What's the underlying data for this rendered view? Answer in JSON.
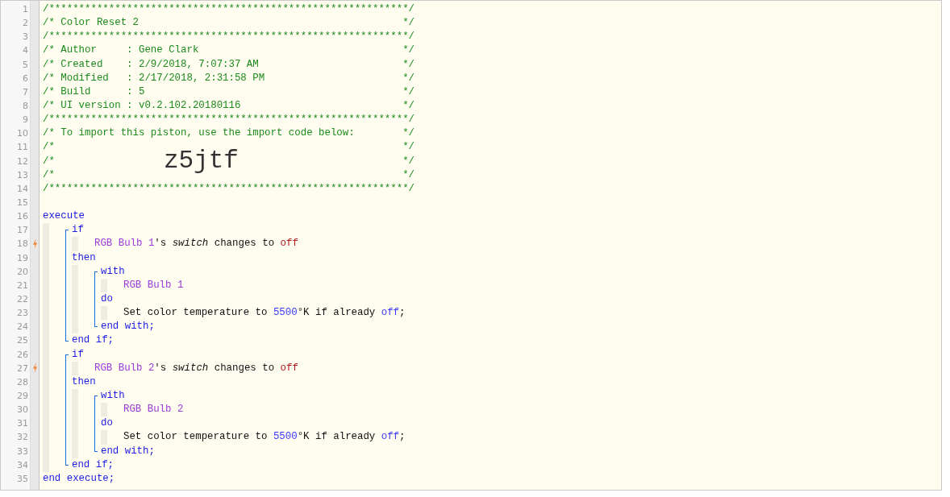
{
  "lines": [
    {
      "number": "1",
      "tokens": [
        {
          "kind": "comment",
          "text": "/************************************************************/"
        }
      ]
    },
    {
      "number": "2",
      "tokens": [
        {
          "kind": "comment",
          "text": "/* Color Reset 2"
        },
        {
          "kind": "comment-end",
          "text": "*/"
        }
      ]
    },
    {
      "number": "3",
      "tokens": [
        {
          "kind": "comment",
          "text": "/************************************************************/"
        }
      ]
    },
    {
      "number": "4",
      "tokens": [
        {
          "kind": "comment",
          "text": "/* Author     : Gene Clark"
        },
        {
          "kind": "comment-end",
          "text": "*/"
        }
      ]
    },
    {
      "number": "5",
      "tokens": [
        {
          "kind": "comment",
          "text": "/* Created    : 2/9/2018, 7:07:37 AM"
        },
        {
          "kind": "comment-end",
          "text": "*/"
        }
      ]
    },
    {
      "number": "6",
      "tokens": [
        {
          "kind": "comment",
          "text": "/* Modified   : 2/17/2018, 2:31:58 PM"
        },
        {
          "kind": "comment-end",
          "text": "*/"
        }
      ]
    },
    {
      "number": "7",
      "tokens": [
        {
          "kind": "comment",
          "text": "/* Build      : 5"
        },
        {
          "kind": "comment-end",
          "text": "*/"
        }
      ]
    },
    {
      "number": "8",
      "tokens": [
        {
          "kind": "comment",
          "text": "/* UI version : v0.2.102.20180116"
        },
        {
          "kind": "comment-end",
          "text": "*/"
        }
      ]
    },
    {
      "number": "9",
      "tokens": [
        {
          "kind": "comment",
          "text": "/************************************************************/"
        }
      ]
    },
    {
      "number": "10",
      "tokens": [
        {
          "kind": "comment",
          "text": "/* To import this piston, use the import code below:"
        },
        {
          "kind": "comment-end",
          "text": "*/"
        }
      ]
    },
    {
      "number": "11",
      "tokens": [
        {
          "kind": "comment",
          "text": "/*"
        },
        {
          "kind": "comment-end",
          "text": "*/"
        }
      ]
    },
    {
      "number": "12",
      "tokens": [
        {
          "kind": "comment",
          "text": "/*"
        },
        {
          "kind": "import-code",
          "text": "z5jtf"
        },
        {
          "kind": "comment-end",
          "text": "*/"
        }
      ]
    },
    {
      "number": "13",
      "tokens": [
        {
          "kind": "comment",
          "text": "/*"
        },
        {
          "kind": "comment-end",
          "text": "*/"
        }
      ]
    },
    {
      "number": "14",
      "tokens": [
        {
          "kind": "comment",
          "text": "/************************************************************/"
        }
      ]
    },
    {
      "number": "15"
    },
    {
      "number": "16",
      "tokens": [
        {
          "kind": "keyword",
          "text": "execute"
        }
      ],
      "children": [
        {
          "number": "17",
          "opens": true,
          "tokens": [
            {
              "kind": "keyword",
              "text": "if"
            }
          ],
          "children": [
            {
              "number": "18",
              "trigger": true,
              "tokens": [
                {
                  "kind": "device",
                  "text": "RGB Bulb 1"
                },
                {
                  "kind": "plain",
                  "text": "'s "
                },
                {
                  "kind": "attribute",
                  "text": "switch"
                },
                {
                  "kind": "plain",
                  "text": " changes to "
                },
                {
                  "kind": "value",
                  "text": "off"
                }
              ]
            }
          ]
        },
        {
          "number": "19",
          "tokens": [
            {
              "kind": "keyword",
              "text": "then"
            }
          ],
          "children": [
            {
              "number": "20",
              "opens": true,
              "tokens": [
                {
                  "kind": "keyword",
                  "text": "with"
                }
              ],
              "children": [
                {
                  "number": "21",
                  "tokens": [
                    {
                      "kind": "device",
                      "text": "RGB Bulb 1"
                    }
                  ]
                }
              ]
            },
            {
              "number": "22",
              "tokens": [
                {
                  "kind": "keyword",
                  "text": "do"
                }
              ],
              "children": [
                {
                  "number": "23",
                  "tokens": [
                    {
                      "kind": "plain",
                      "text": "Set color temperature to "
                    },
                    {
                      "kind": "number",
                      "text": "5500"
                    },
                    {
                      "kind": "plain",
                      "text": "°K if already "
                    },
                    {
                      "kind": "number",
                      "text": "off"
                    },
                    {
                      "kind": "plain",
                      "text": ";"
                    }
                  ]
                }
              ]
            },
            {
              "number": "24",
              "closes": true,
              "tokens": [
                {
                  "kind": "keyword",
                  "text": "end with;"
                }
              ]
            }
          ]
        },
        {
          "number": "25",
          "closes": true,
          "tokens": [
            {
              "kind": "keyword",
              "text": "end if;"
            }
          ]
        },
        {
          "number": "26",
          "opens": true,
          "tokens": [
            {
              "kind": "keyword",
              "text": "if"
            }
          ],
          "children": [
            {
              "number": "27",
              "trigger": true,
              "tokens": [
                {
                  "kind": "device",
                  "text": "RGB Bulb 2"
                },
                {
                  "kind": "plain",
                  "text": "'s "
                },
                {
                  "kind": "attribute",
                  "text": "switch"
                },
                {
                  "kind": "plain",
                  "text": " changes to "
                },
                {
                  "kind": "value",
                  "text": "off"
                }
              ]
            }
          ]
        },
        {
          "number": "28",
          "tokens": [
            {
              "kind": "keyword",
              "text": "then"
            }
          ],
          "children": [
            {
              "number": "29",
              "opens": true,
              "tokens": [
                {
                  "kind": "keyword",
                  "text": "with"
                }
              ],
              "children": [
                {
                  "number": "30",
                  "tokens": [
                    {
                      "kind": "device",
                      "text": "RGB Bulb 2"
                    }
                  ]
                }
              ]
            },
            {
              "number": "31",
              "tokens": [
                {
                  "kind": "keyword",
                  "text": "do"
                }
              ],
              "children": [
                {
                  "number": "32",
                  "tokens": [
                    {
                      "kind": "plain",
                      "text": "Set color temperature to "
                    },
                    {
                      "kind": "number",
                      "text": "5500"
                    },
                    {
                      "kind": "plain",
                      "text": "°K if already "
                    },
                    {
                      "kind": "number",
                      "text": "off"
                    },
                    {
                      "kind": "plain",
                      "text": ";"
                    }
                  ]
                }
              ]
            },
            {
              "number": "33",
              "closes": true,
              "tokens": [
                {
                  "kind": "keyword",
                  "text": "end with;"
                }
              ]
            }
          ]
        },
        {
          "number": "34",
          "closes": true,
          "tokens": [
            {
              "kind": "keyword",
              "text": "end if;"
            }
          ]
        }
      ]
    },
    {
      "number": "35",
      "tokens": [
        {
          "kind": "keyword",
          "text": "end execute;"
        }
      ]
    }
  ]
}
